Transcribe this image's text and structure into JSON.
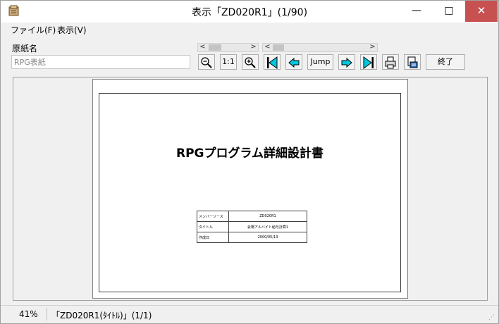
{
  "window": {
    "title": "表示「ZD020R1」(1/90)",
    "minimize_glyph": "—",
    "maximize_glyph": "□",
    "close_glyph": "✕"
  },
  "menu": {
    "items": [
      {
        "label": "ファイル(F)"
      },
      {
        "label": "表示(V)"
      }
    ]
  },
  "toolbar": {
    "source_label": "原紙名",
    "source_value": "RPG表紙",
    "zoom_out_icon": "zoom-out-icon",
    "actual_size_label": "1:1",
    "zoom_in_icon": "zoom-in-icon",
    "first_icon": "first-page-icon",
    "prev_icon": "prev-page-icon",
    "jump_label": "Jump",
    "next_icon": "next-page-icon",
    "last_icon": "last-page-icon",
    "print_icon": "print-icon",
    "export_icon": "export-icon",
    "exit_label": "終了"
  },
  "document": {
    "title": "RPGプログラム詳細設計書",
    "table": [
      {
        "key": "メンバーソース",
        "value": "ZD020R1"
      },
      {
        "key": "タイトル",
        "value": "会場アルバイト給与計算1"
      },
      {
        "key": "作成日",
        "value": "2000/05/13"
      }
    ]
  },
  "status": {
    "zoom": "41%",
    "page_info": "「ZD020R1(ﾀｲﾄﾙ)」(1/1)"
  },
  "colors": {
    "accent_cyan": "#00c8e0",
    "close_red": "#c75050"
  }
}
